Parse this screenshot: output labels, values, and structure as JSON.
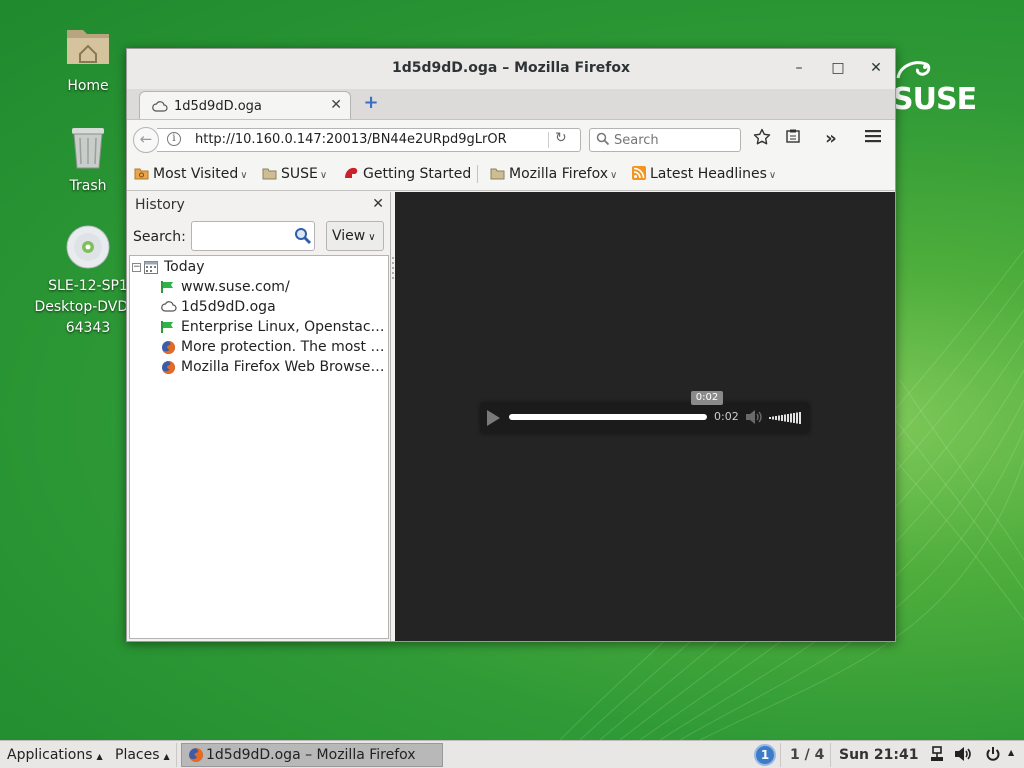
{
  "desktop": {
    "icons": [
      {
        "label_lines": [
          "Home"
        ]
      },
      {
        "label_lines": [
          "Trash"
        ]
      },
      {
        "label_lines": [
          "SLE-12-SP1",
          "Desktop-DVD-x",
          "64343"
        ]
      }
    ],
    "logo_text": "SUSE",
    "colors": {
      "background": "#2f9a36",
      "accent": "#4fae3c"
    }
  },
  "window": {
    "title": "1d5d9dD.oga – Mozilla Firefox",
    "controls": {
      "minimize": "–",
      "maximize": "□",
      "close": "✕"
    },
    "tab": {
      "label": "1d5d9dD.oga",
      "close": "✕"
    },
    "newtab": "+",
    "navbar": {
      "url": "http://10.160.0.147:20013/BN44e2URpd9gLrOR",
      "info": "i",
      "reload": "↻",
      "search_placeholder": "Search",
      "overflow": "»"
    },
    "bookmarks": [
      {
        "label": "Most Visited"
      },
      {
        "label": "SUSE"
      },
      {
        "label": "Getting Started"
      },
      {
        "label": "Mozilla Firefox"
      },
      {
        "label": "Latest Headlines"
      }
    ],
    "sidebar": {
      "title": "History",
      "close": "✕",
      "search_label": "Search:",
      "view_label": "View",
      "tree": {
        "group_label": "Today",
        "items": [
          {
            "label": "www.suse.com/",
            "icon": "suse-chameleon-icon"
          },
          {
            "label": "1d5d9dD.oga",
            "icon": "cloud-icon"
          },
          {
            "label": "Enterprise Linux, Openstack c...",
            "icon": "suse-chameleon-icon"
          },
          {
            "label": "More protection. The most pri...",
            "icon": "firefox-icon"
          },
          {
            "label": "Mozilla Firefox Web Browser ...",
            "icon": "firefox-icon"
          }
        ]
      }
    },
    "player": {
      "time": "0:02",
      "tooltip": "0:02",
      "progress": 1.0
    }
  },
  "taskbar": {
    "applications": "Applications",
    "places": "Places",
    "window_label": "1d5d9dD.oga – Mozilla Firefox",
    "workspace_badge": "1",
    "workspace": "1 / 4",
    "clock": "Sun 21:41"
  }
}
